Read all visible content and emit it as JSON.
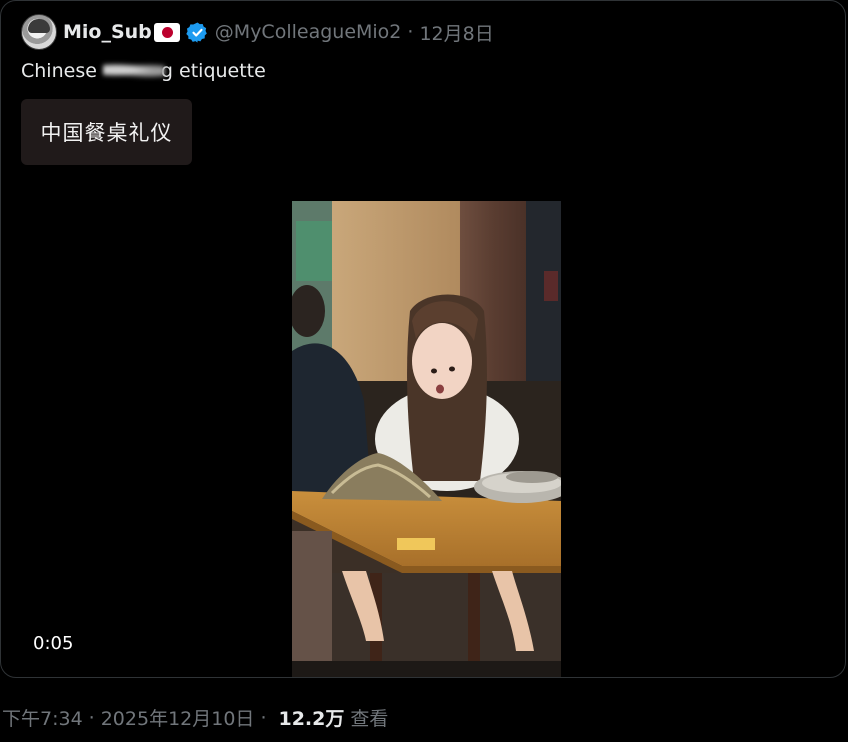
{
  "quoted_tweet": {
    "author": {
      "display_name": "Mio_Sub",
      "handle": "@MyColleagueMio2",
      "date": "12月8日",
      "flag_icon": "japan-flag-icon",
      "verified_icon": "verified-badge-icon",
      "verified_color": "#1d9bf0"
    },
    "text_before": "Chinese",
    "text_after": "g etiquette",
    "caption_box_text": "中国餐桌礼仪",
    "video": {
      "duration": "0:05"
    }
  },
  "meta": {
    "time": "下午7:34",
    "date": "2025年12月10日",
    "views_count": "12.2万",
    "views_label": "查看",
    "separator": "·"
  },
  "colors": {
    "background": "#000000",
    "text_primary": "#e7e9ea",
    "text_secondary": "#71767b",
    "border": "#2f3336"
  }
}
